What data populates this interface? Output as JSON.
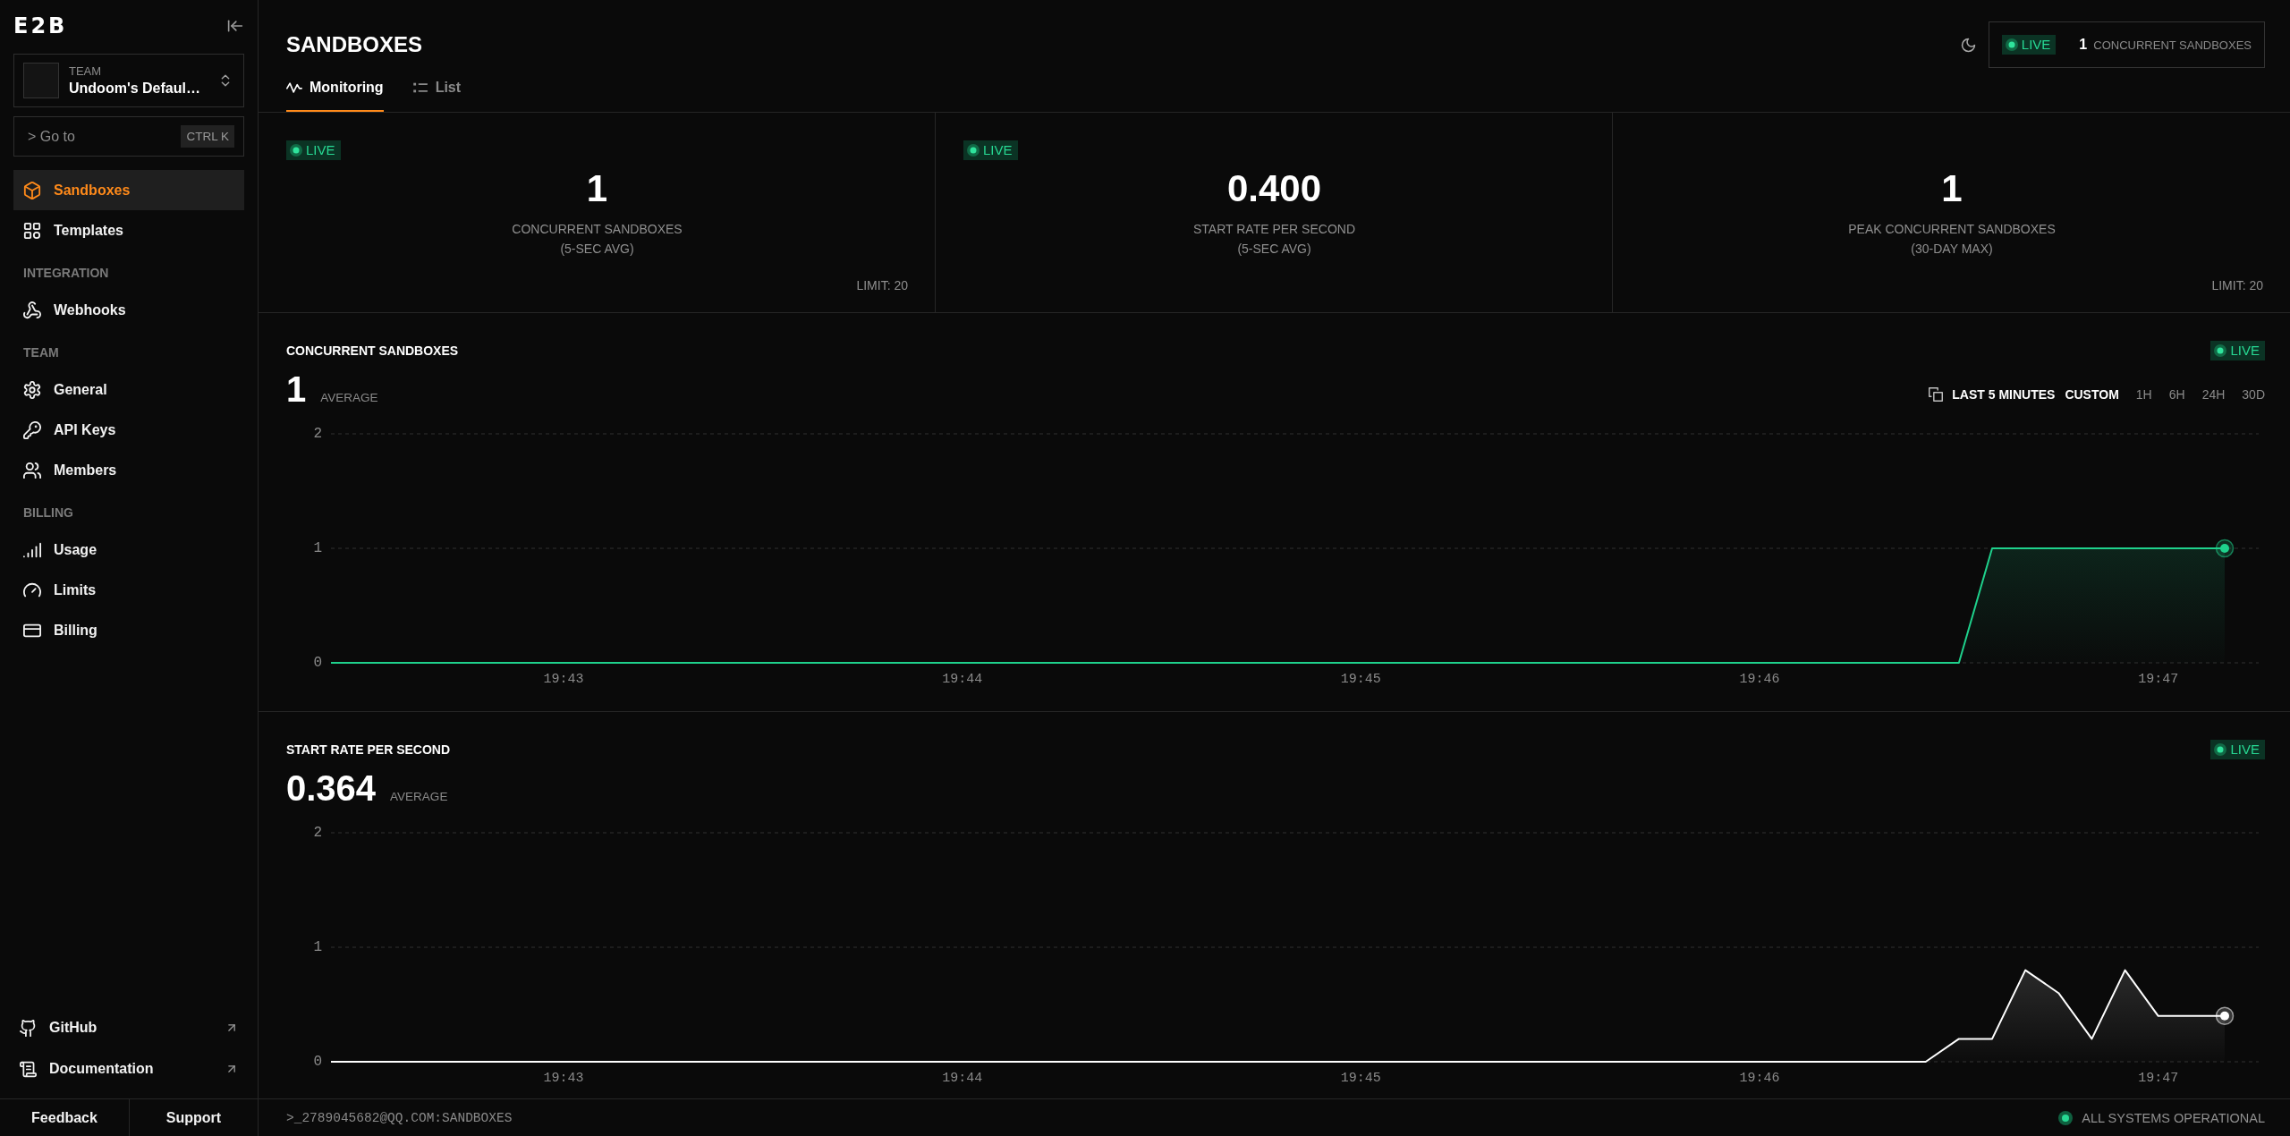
{
  "sidebar": {
    "logo": "E2B",
    "team": {
      "label": "TEAM",
      "name": "Undoom's Defaul…"
    },
    "goto": {
      "placeholder": "> Go to",
      "shortcut": "CTRL K"
    },
    "sections": [
      {
        "items": [
          {
            "label": "Sandboxes",
            "selected": true
          },
          {
            "label": "Templates",
            "selected": false
          }
        ]
      },
      {
        "heading": "INTEGRATION",
        "items": [
          {
            "label": "Webhooks",
            "selected": false
          }
        ]
      },
      {
        "heading": "TEAM",
        "items": [
          {
            "label": "General",
            "selected": false
          },
          {
            "label": "API Keys",
            "selected": false
          },
          {
            "label": "Members",
            "selected": false
          }
        ]
      },
      {
        "heading": "BILLING",
        "items": [
          {
            "label": "Usage",
            "selected": false
          },
          {
            "label": "Limits",
            "selected": false
          },
          {
            "label": "Billing",
            "selected": false
          }
        ]
      }
    ],
    "links": [
      {
        "label": "GitHub"
      },
      {
        "label": "Documentation"
      }
    ],
    "footer_buttons": [
      "Feedback",
      "Support"
    ]
  },
  "header": {
    "title": "SANDBOXES",
    "tabs": [
      {
        "label": "Monitoring",
        "selected": true
      },
      {
        "label": "List",
        "selected": false
      }
    ],
    "live_counter": {
      "badge": "LIVE",
      "value": "1",
      "label": "CONCURRENT SANDBOXES"
    }
  },
  "stats": [
    {
      "badge": "LIVE",
      "value": "1",
      "label": "CONCURRENT SANDBOXES",
      "sublabel": "(5-SEC AVG)",
      "limit": "LIMIT: 20"
    },
    {
      "badge": "LIVE",
      "value": "0.400",
      "label": "START RATE PER SECOND",
      "sublabel": "(5-SEC AVG)"
    },
    {
      "value": "1",
      "label": "PEAK CONCURRENT SANDBOXES",
      "sublabel": "(30-DAY MAX)",
      "limit": "LIMIT: 20"
    }
  ],
  "charts": [
    {
      "title": "CONCURRENT SANDBOXES",
      "badge": "LIVE",
      "average": "1",
      "average_label": "AVERAGE",
      "range_picker": {
        "current": "LAST 5 MINUTES",
        "options": [
          {
            "label": "CUSTOM",
            "selected": true
          },
          {
            "label": "1H",
            "selected": false
          },
          {
            "label": "6H",
            "selected": false
          },
          {
            "label": "24H",
            "selected": false
          },
          {
            "label": "30D",
            "selected": false
          }
        ]
      },
      "chart_data": {
        "type": "area",
        "ylim": [
          0,
          2
        ],
        "yticks": [
          0,
          1,
          2
        ],
        "categories": [
          null,
          null,
          null,
          null,
          null,
          null,
          null,
          "19:43",
          null,
          null,
          null,
          null,
          null,
          null,
          null,
          null,
          null,
          null,
          null,
          "19:44",
          null,
          null,
          null,
          null,
          null,
          null,
          null,
          null,
          null,
          null,
          null,
          "19:45",
          null,
          null,
          null,
          null,
          null,
          null,
          null,
          null,
          null,
          null,
          null,
          "19:46",
          null,
          null,
          null,
          null,
          null,
          null,
          null,
          null,
          null,
          null,
          null,
          "19:47",
          null,
          null
        ],
        "series": [
          {
            "color": "#1fd18c",
            "values": [
              0,
              0,
              0,
              0,
              0,
              0,
              0,
              0,
              0,
              0,
              0,
              0,
              0,
              0,
              0,
              0,
              0,
              0,
              0,
              0,
              0,
              0,
              0,
              0,
              0,
              0,
              0,
              0,
              0,
              0,
              0,
              0,
              0,
              0,
              0,
              0,
              0,
              0,
              0,
              0,
              0,
              0,
              0,
              0,
              0,
              0,
              0,
              0,
              0,
              0,
              1,
              1,
              1,
              1,
              1,
              1,
              1,
              1
            ]
          }
        ]
      }
    },
    {
      "title": "START RATE PER SECOND",
      "badge": "LIVE",
      "average": "0.364",
      "average_label": "AVERAGE",
      "chart_data": {
        "type": "area",
        "ylim": [
          0,
          2
        ],
        "yticks": [
          0,
          1,
          2
        ],
        "categories": [
          null,
          null,
          null,
          null,
          null,
          null,
          null,
          "19:43",
          null,
          null,
          null,
          null,
          null,
          null,
          null,
          null,
          null,
          null,
          null,
          "19:44",
          null,
          null,
          null,
          null,
          null,
          null,
          null,
          null,
          null,
          null,
          null,
          "19:45",
          null,
          null,
          null,
          null,
          null,
          null,
          null,
          null,
          null,
          null,
          null,
          "19:46",
          null,
          null,
          null,
          null,
          null,
          null,
          null,
          null,
          null,
          null,
          null,
          "19:47",
          null,
          null
        ],
        "series": [
          {
            "color": "#ffffff",
            "values": [
              0,
              0,
              0,
              0,
              0,
              0,
              0,
              0,
              0,
              0,
              0,
              0,
              0,
              0,
              0,
              0,
              0,
              0,
              0,
              0,
              0,
              0,
              0,
              0,
              0,
              0,
              0,
              0,
              0,
              0,
              0,
              0,
              0,
              0,
              0,
              0,
              0,
              0,
              0,
              0,
              0,
              0,
              0,
              0,
              0,
              0,
              0,
              0,
              0,
              0.2,
              0.2,
              0.8,
              0.6,
              0.2,
              0.8,
              0.4,
              0.4,
              0.4
            ]
          }
        ]
      }
    }
  ],
  "status_bar": {
    "path": ">_2789045682@QQ.COM:SANDBOXES",
    "status": "ALL SYSTEMS OPERATIONAL"
  }
}
